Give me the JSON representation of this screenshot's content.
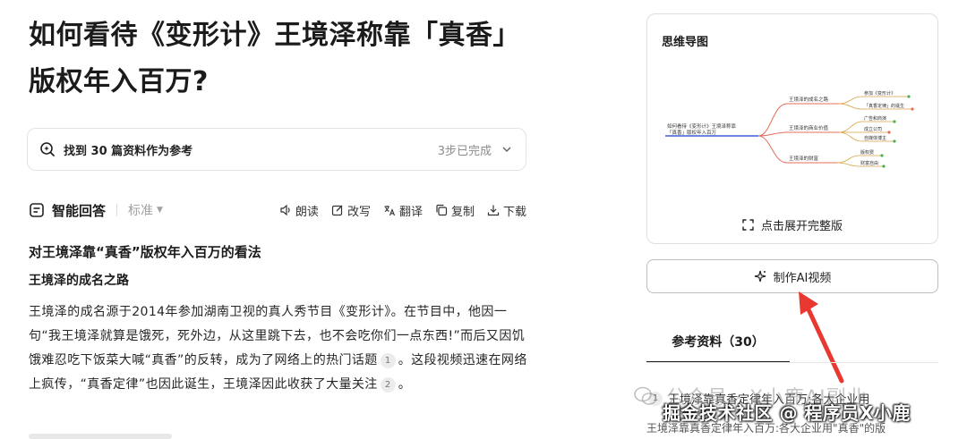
{
  "title": "如何看待《变形计》王境泽称靠「真香」版权年入百万?",
  "references_bar": {
    "label": "找到 30 篇资料作为参考",
    "status": "3步已完成"
  },
  "answer_bar": {
    "title": "智能回答",
    "mode": "标准",
    "actions": [
      "朗读",
      "改写",
      "翻译",
      "复制",
      "下载"
    ]
  },
  "content": {
    "heading": "对王境泽靠“真香”版权年入百万的看法",
    "subheading": "王境泽的成名之路",
    "para_part1": "王境泽的成名源于2014年参加湖南卫视的真人秀节目《变形计》。在节目中，他因一句“我王境泽就算是饿死，死外边，从这里跳下去，也不会吃你们一点东西!”而后又因饥饿难忍吃下饭菜大喊“真香”的反转，成为了网络上的热门话题",
    "cite1": "1",
    "para_part2": "。这段视频迅速在网络上疯传，“真香定律”也因此诞生，王境泽因此收获了大量关注",
    "cite2": "2",
    "para_part3": "。"
  },
  "mindmap": {
    "title": "思维导图",
    "root": "如何看待《变形计》王境泽称靠「真香」版权年入百万",
    "branches": [
      {
        "label": "王境泽的成名之路",
        "children": [
          "参加《变形计》",
          "「真香定律」的诞生"
        ]
      },
      {
        "label": "王境泽的商业价值",
        "children": [
          "广告和商演",
          "成立公司",
          "自媒体博主"
        ]
      },
      {
        "label": "王境泽的财富",
        "children": [
          "版权费",
          "财富自由"
        ]
      }
    ],
    "expand_label": "点击展开完整版"
  },
  "video_button": "制作AI视频",
  "references": {
    "tab_label": "参考资料（30）",
    "first_item_num": "1",
    "first_item_text": "王境泽靠真香定律年入百万:各大企业用"
  },
  "watermarks": {
    "main": "掘金技术社区 @ 程序员X小鹿",
    "public_account": "公众号 · X小鹿AI副业",
    "caption": "王境泽靠真香定律年入百万:各大企业用\"真香\"的版"
  },
  "colors": {
    "arrow": "#e8382f",
    "mindmap_root_line": "#3b5bdb",
    "branch_line": "#e36c5a"
  }
}
